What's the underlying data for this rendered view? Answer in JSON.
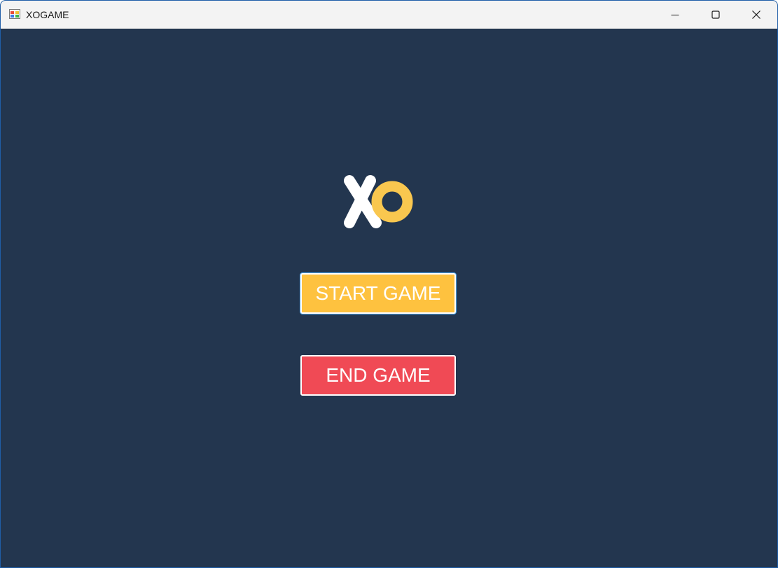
{
  "window": {
    "title": "XOGAME",
    "controls": {
      "minimize_icon": "minimize-icon",
      "maximize_icon": "maximize-icon",
      "close_icon": "close-icon"
    }
  },
  "main": {
    "logo_icon": "xo-logo",
    "start_label": "START GAME",
    "end_label": "END GAME"
  },
  "colors": {
    "background": "#23364f",
    "start_button": "#fec23f",
    "end_button": "#f04a55",
    "logo_o": "#f9c74f",
    "logo_x": "#ffffff"
  }
}
